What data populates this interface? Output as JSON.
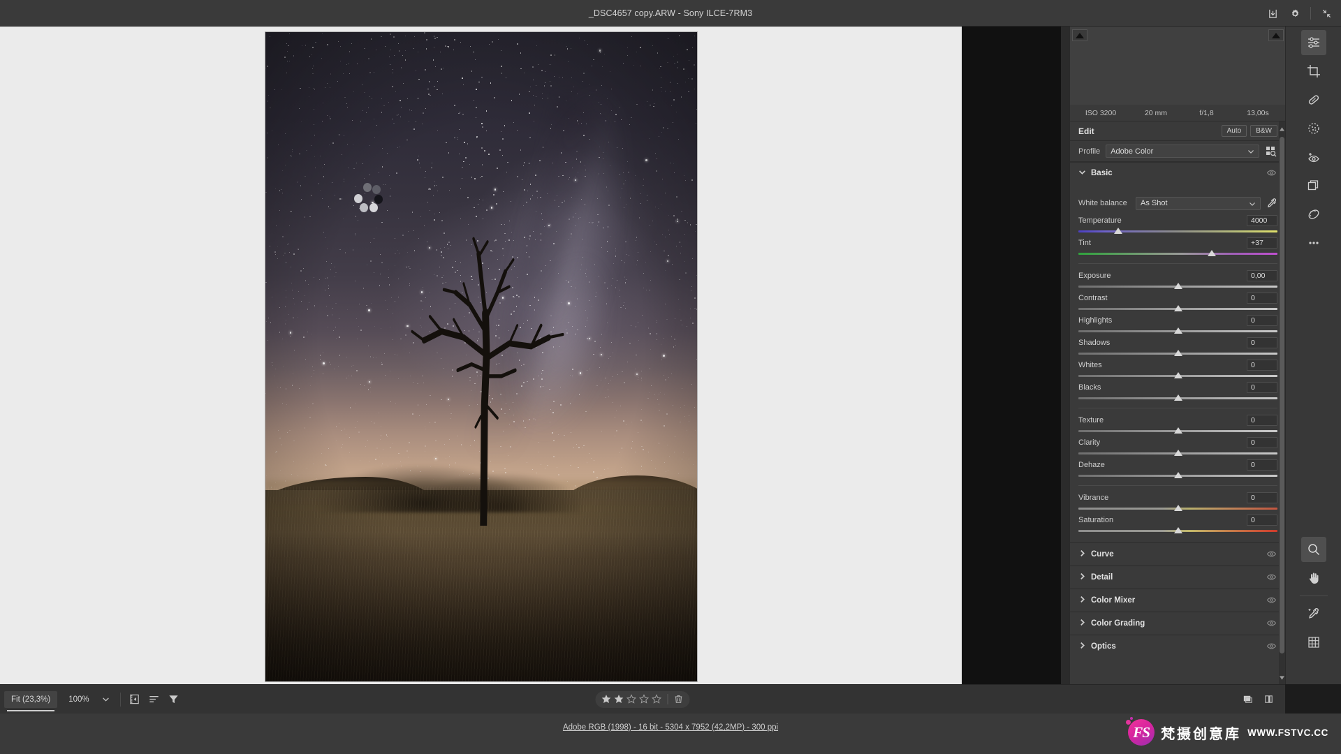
{
  "titlebar": {
    "title": "_DSC4657 copy.ARW  -  Sony ILCE-7RM3",
    "icons": {
      "save": "save-icon",
      "settings": "gear-icon",
      "collapse": "collapse-icon"
    }
  },
  "panel": {
    "exif": {
      "iso": "ISO 3200",
      "focal": "20 mm",
      "aperture": "f/1,8",
      "shutter": "13,00s"
    },
    "edit": {
      "title": "Edit",
      "auto": "Auto",
      "bw": "B&W"
    },
    "profile": {
      "label": "Profile",
      "value": "Adobe Color"
    },
    "basic": {
      "title": "Basic",
      "white_balance_label": "White balance",
      "white_balance_value": "As Shot",
      "sliders": [
        {
          "name": "Temperature",
          "value": "4000",
          "pos": 20,
          "bar": "temp"
        },
        {
          "name": "Tint",
          "value": "+37",
          "pos": 67,
          "bar": "tint"
        },
        {
          "name": "Exposure",
          "value": "0,00",
          "pos": 50,
          "bar": "plain"
        },
        {
          "name": "Contrast",
          "value": "0",
          "pos": 50,
          "bar": "plain"
        },
        {
          "name": "Highlights",
          "value": "0",
          "pos": 50,
          "bar": "plain"
        },
        {
          "name": "Shadows",
          "value": "0",
          "pos": 50,
          "bar": "plain"
        },
        {
          "name": "Whites",
          "value": "0",
          "pos": 50,
          "bar": "plain"
        },
        {
          "name": "Blacks",
          "value": "0",
          "pos": 50,
          "bar": "plain"
        },
        {
          "name": "Texture",
          "value": "0",
          "pos": 50,
          "bar": "plain"
        },
        {
          "name": "Clarity",
          "value": "0",
          "pos": 50,
          "bar": "plain"
        },
        {
          "name": "Dehaze",
          "value": "0",
          "pos": 50,
          "bar": "plain"
        },
        {
          "name": "Vibrance",
          "value": "0",
          "pos": 50,
          "bar": "vib"
        },
        {
          "name": "Saturation",
          "value": "0",
          "pos": 50,
          "bar": "sat"
        }
      ]
    },
    "collapsed_sections": [
      {
        "name": "Curve"
      },
      {
        "name": "Detail"
      },
      {
        "name": "Color Mixer"
      },
      {
        "name": "Color Grading"
      },
      {
        "name": "Optics"
      }
    ]
  },
  "toolbar_right": {
    "top": [
      "edit-sliders-icon",
      "crop-icon",
      "healing-brush-icon",
      "masking-icon",
      "red-eye-icon",
      "presets-icon",
      "snapshots-icon",
      "more-options-icon"
    ],
    "bottom": [
      "zoom-icon",
      "hand-icon",
      "white-balance-eyedropper-icon",
      "grid-overlay-icon"
    ]
  },
  "bottombar": {
    "fit_label": "Fit (23,3%)",
    "zoom_label": "100%",
    "rating": {
      "filled": 2,
      "total": 5
    },
    "icons": [
      "filmstrip-icon",
      "sort-icon",
      "filter-icon",
      "delete-icon",
      "single-view-icon",
      "compare-view-icon"
    ]
  },
  "footer": {
    "info": "Adobe RGB (1998) - 16 bit - 5304 x 7952 (42,2MP) - 300 ppi",
    "watermark": {
      "logo_text": "FS",
      "cn": "梵摄创意库",
      "url": "WWW.FSTVC.CC"
    }
  },
  "colors": {
    "panel_bg": "#3a3a3a",
    "canvas_bg": "#ebebeb",
    "accent_pink": "#e2349c"
  }
}
